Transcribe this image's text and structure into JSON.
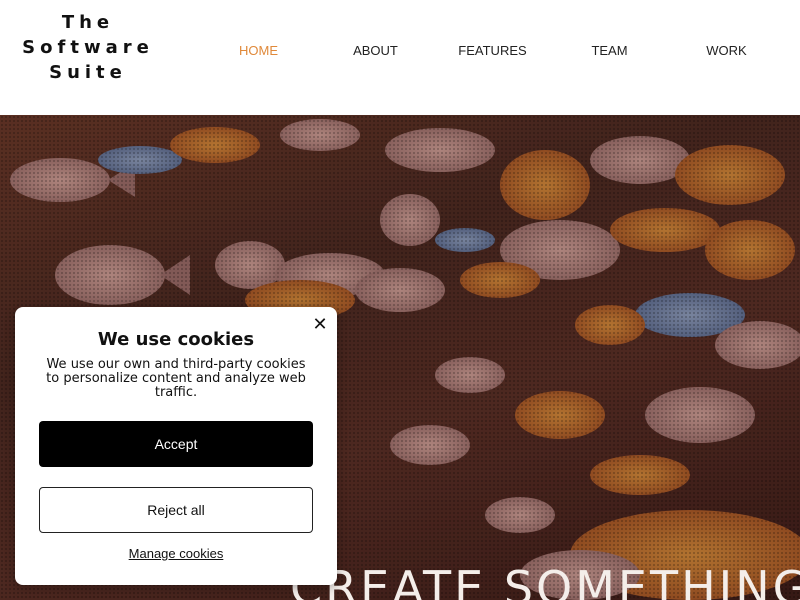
{
  "header": {
    "logo_lines": [
      "The",
      "Software",
      "Suite"
    ],
    "nav": [
      {
        "label": "HOME",
        "active": true
      },
      {
        "label": "ABOUT",
        "active": false
      },
      {
        "label": "FEATURES",
        "active": false
      },
      {
        "label": "TEAM",
        "active": false
      },
      {
        "label": "WORK",
        "active": false
      }
    ],
    "accent_color": "#e0893a"
  },
  "hero": {
    "title": "CREATE SOMETHING"
  },
  "cookie_dialog": {
    "title": "We use cookies",
    "text": "We use our own and third-party cookies to personalize content and analyze web traffic.",
    "accept_label": "Accept",
    "reject_label": "Reject all",
    "manage_label": "Manage cookies",
    "close_icon": "close-icon"
  }
}
